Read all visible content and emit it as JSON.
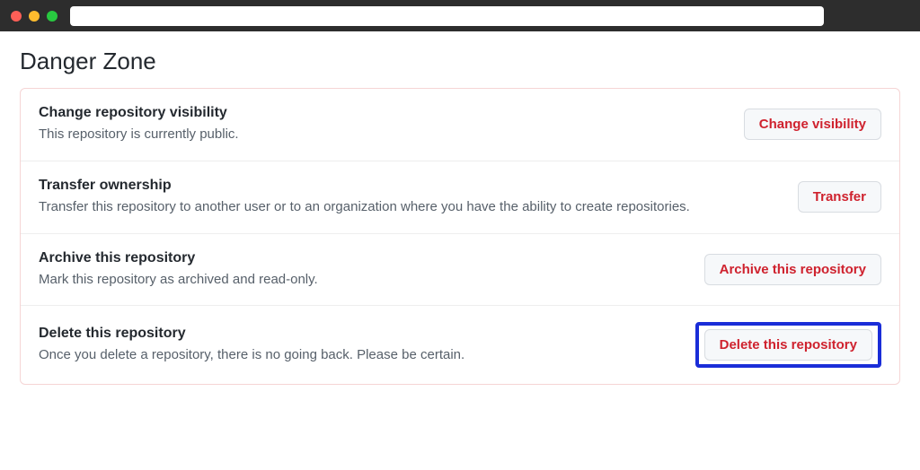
{
  "page": {
    "title": "Danger Zone"
  },
  "rows": [
    {
      "title": "Change repository visibility",
      "desc": "This repository is currently public.",
      "button": "Change visibility"
    },
    {
      "title": "Transfer ownership",
      "desc": "Transfer this repository to another user or to an organization where you have the ability to create repositories.",
      "button": "Transfer"
    },
    {
      "title": "Archive this repository",
      "desc": "Mark this repository as archived and read-only.",
      "button": "Archive this repository"
    },
    {
      "title": "Delete this repository",
      "desc": "Once you delete a repository, there is no going back. Please be certain.",
      "button": "Delete this repository"
    }
  ]
}
